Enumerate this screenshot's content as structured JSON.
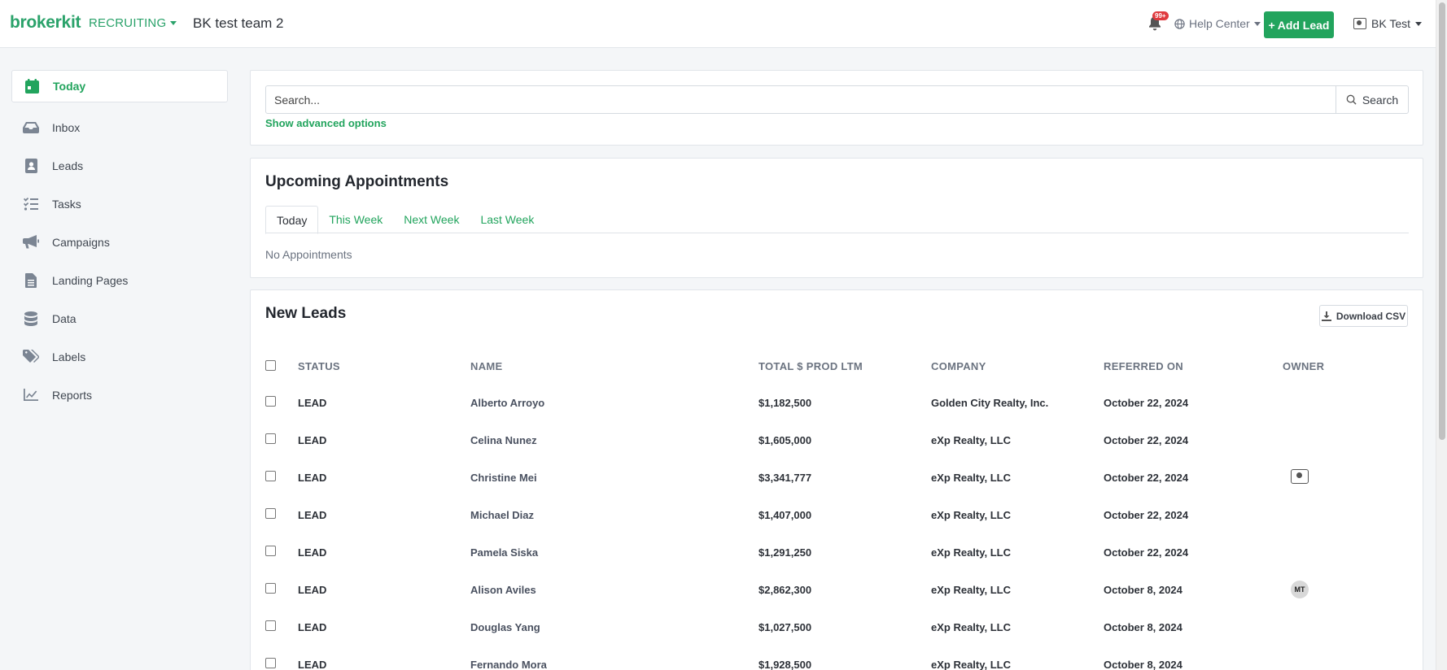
{
  "topbar": {
    "brand": "brokerkit",
    "module": "RECRUITING",
    "team": "BK test team 2",
    "notification_badge": "99+",
    "help_center": "Help Center",
    "add_lead": "Add Lead",
    "user": "BK Test"
  },
  "sidebar": {
    "items": [
      {
        "label": "Today",
        "icon": "calendar-icon"
      },
      {
        "label": "Inbox",
        "icon": "inbox-icon"
      },
      {
        "label": "Leads",
        "icon": "contact-book-icon"
      },
      {
        "label": "Tasks",
        "icon": "tasks-icon"
      },
      {
        "label": "Campaigns",
        "icon": "megaphone-icon"
      },
      {
        "label": "Landing Pages",
        "icon": "document-icon"
      },
      {
        "label": "Data",
        "icon": "database-icon"
      },
      {
        "label": "Labels",
        "icon": "tags-icon"
      },
      {
        "label": "Reports",
        "icon": "chart-line-icon"
      }
    ]
  },
  "search": {
    "placeholder": "Search...",
    "button": "Search",
    "advanced": "Show advanced options"
  },
  "appointments": {
    "title": "Upcoming Appointments",
    "tabs": [
      "Today",
      "This Week",
      "Next Week",
      "Last Week"
    ],
    "empty": "No Appointments"
  },
  "leads": {
    "title": "New Leads",
    "download": "Download CSV",
    "columns": [
      "STATUS",
      "NAME",
      "TOTAL $ PROD LTM",
      "COMPANY",
      "REFERRED ON",
      "OWNER"
    ],
    "rows": [
      {
        "status": "LEAD",
        "name": "Alberto Arroyo",
        "prod": "$1,182,500",
        "company": "Golden City Realty, Inc.",
        "referred": "October 22, 2024",
        "owner": ""
      },
      {
        "status": "LEAD",
        "name": "Celina Nunez",
        "prod": "$1,605,000",
        "company": "eXp Realty, LLC",
        "referred": "October 22, 2024",
        "owner": ""
      },
      {
        "status": "LEAD",
        "name": "Christine Mei",
        "prod": "$3,341,777",
        "company": "eXp Realty, LLC",
        "referred": "October 22, 2024",
        "owner": "robot"
      },
      {
        "status": "LEAD",
        "name": "Michael Diaz",
        "prod": "$1,407,000",
        "company": "eXp Realty, LLC",
        "referred": "October 22, 2024",
        "owner": ""
      },
      {
        "status": "LEAD",
        "name": "Pamela Siska",
        "prod": "$1,291,250",
        "company": "eXp Realty, LLC",
        "referred": "October 22, 2024",
        "owner": ""
      },
      {
        "status": "LEAD",
        "name": "Alison Aviles",
        "prod": "$2,862,300",
        "company": "eXp Realty, LLC",
        "referred": "October 8, 2024",
        "owner": "MT"
      },
      {
        "status": "LEAD",
        "name": "Douglas Yang",
        "prod": "$1,027,500",
        "company": "eXp Realty, LLC",
        "referred": "October 8, 2024",
        "owner": ""
      },
      {
        "status": "LEAD",
        "name": "Fernando Mora",
        "prod": "$1,928,500",
        "company": "eXp Realty, LLC",
        "referred": "October 8, 2024",
        "owner": ""
      }
    ]
  },
  "colors": {
    "accent": "#22a45d",
    "badge": "#e03a3e"
  }
}
